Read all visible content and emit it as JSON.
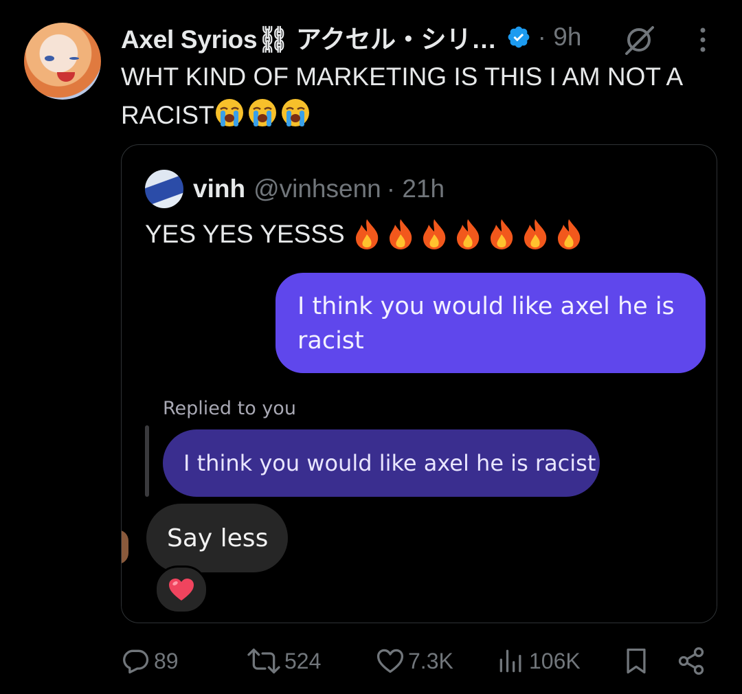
{
  "tweet": {
    "author_name": "Axel Syrios⛓ アクセル・シリ…",
    "time": "· 9h",
    "text": "WHT KIND OF MARKETING IS THIS I AM NOT A RACIST",
    "text_emojis": [
      "loudly-crying-face",
      "loudly-crying-face",
      "loudly-crying-face"
    ],
    "verified": true,
    "accent_color": "#1d9bf0"
  },
  "quote": {
    "name": "vinh",
    "handle": "@vinhsenn",
    "time": "· 21h",
    "text": "YES YES YESSS",
    "text_emojis": [
      "fire",
      "fire",
      "fire",
      "fire",
      "fire",
      "fire",
      "fire"
    ],
    "chat": {
      "sent_message": "I think you would like axel he is racist",
      "replied_label": "Replied to you",
      "replied_message": "I think you would like axel he is racist",
      "received_message": "Say less",
      "reaction": "red-heart",
      "sent_bubble_color": "#5f47ec",
      "replied_bubble_color": "#3a2e8f"
    }
  },
  "actions": {
    "replies": "89",
    "reposts": "524",
    "likes": "7.3K",
    "views": "106K"
  }
}
